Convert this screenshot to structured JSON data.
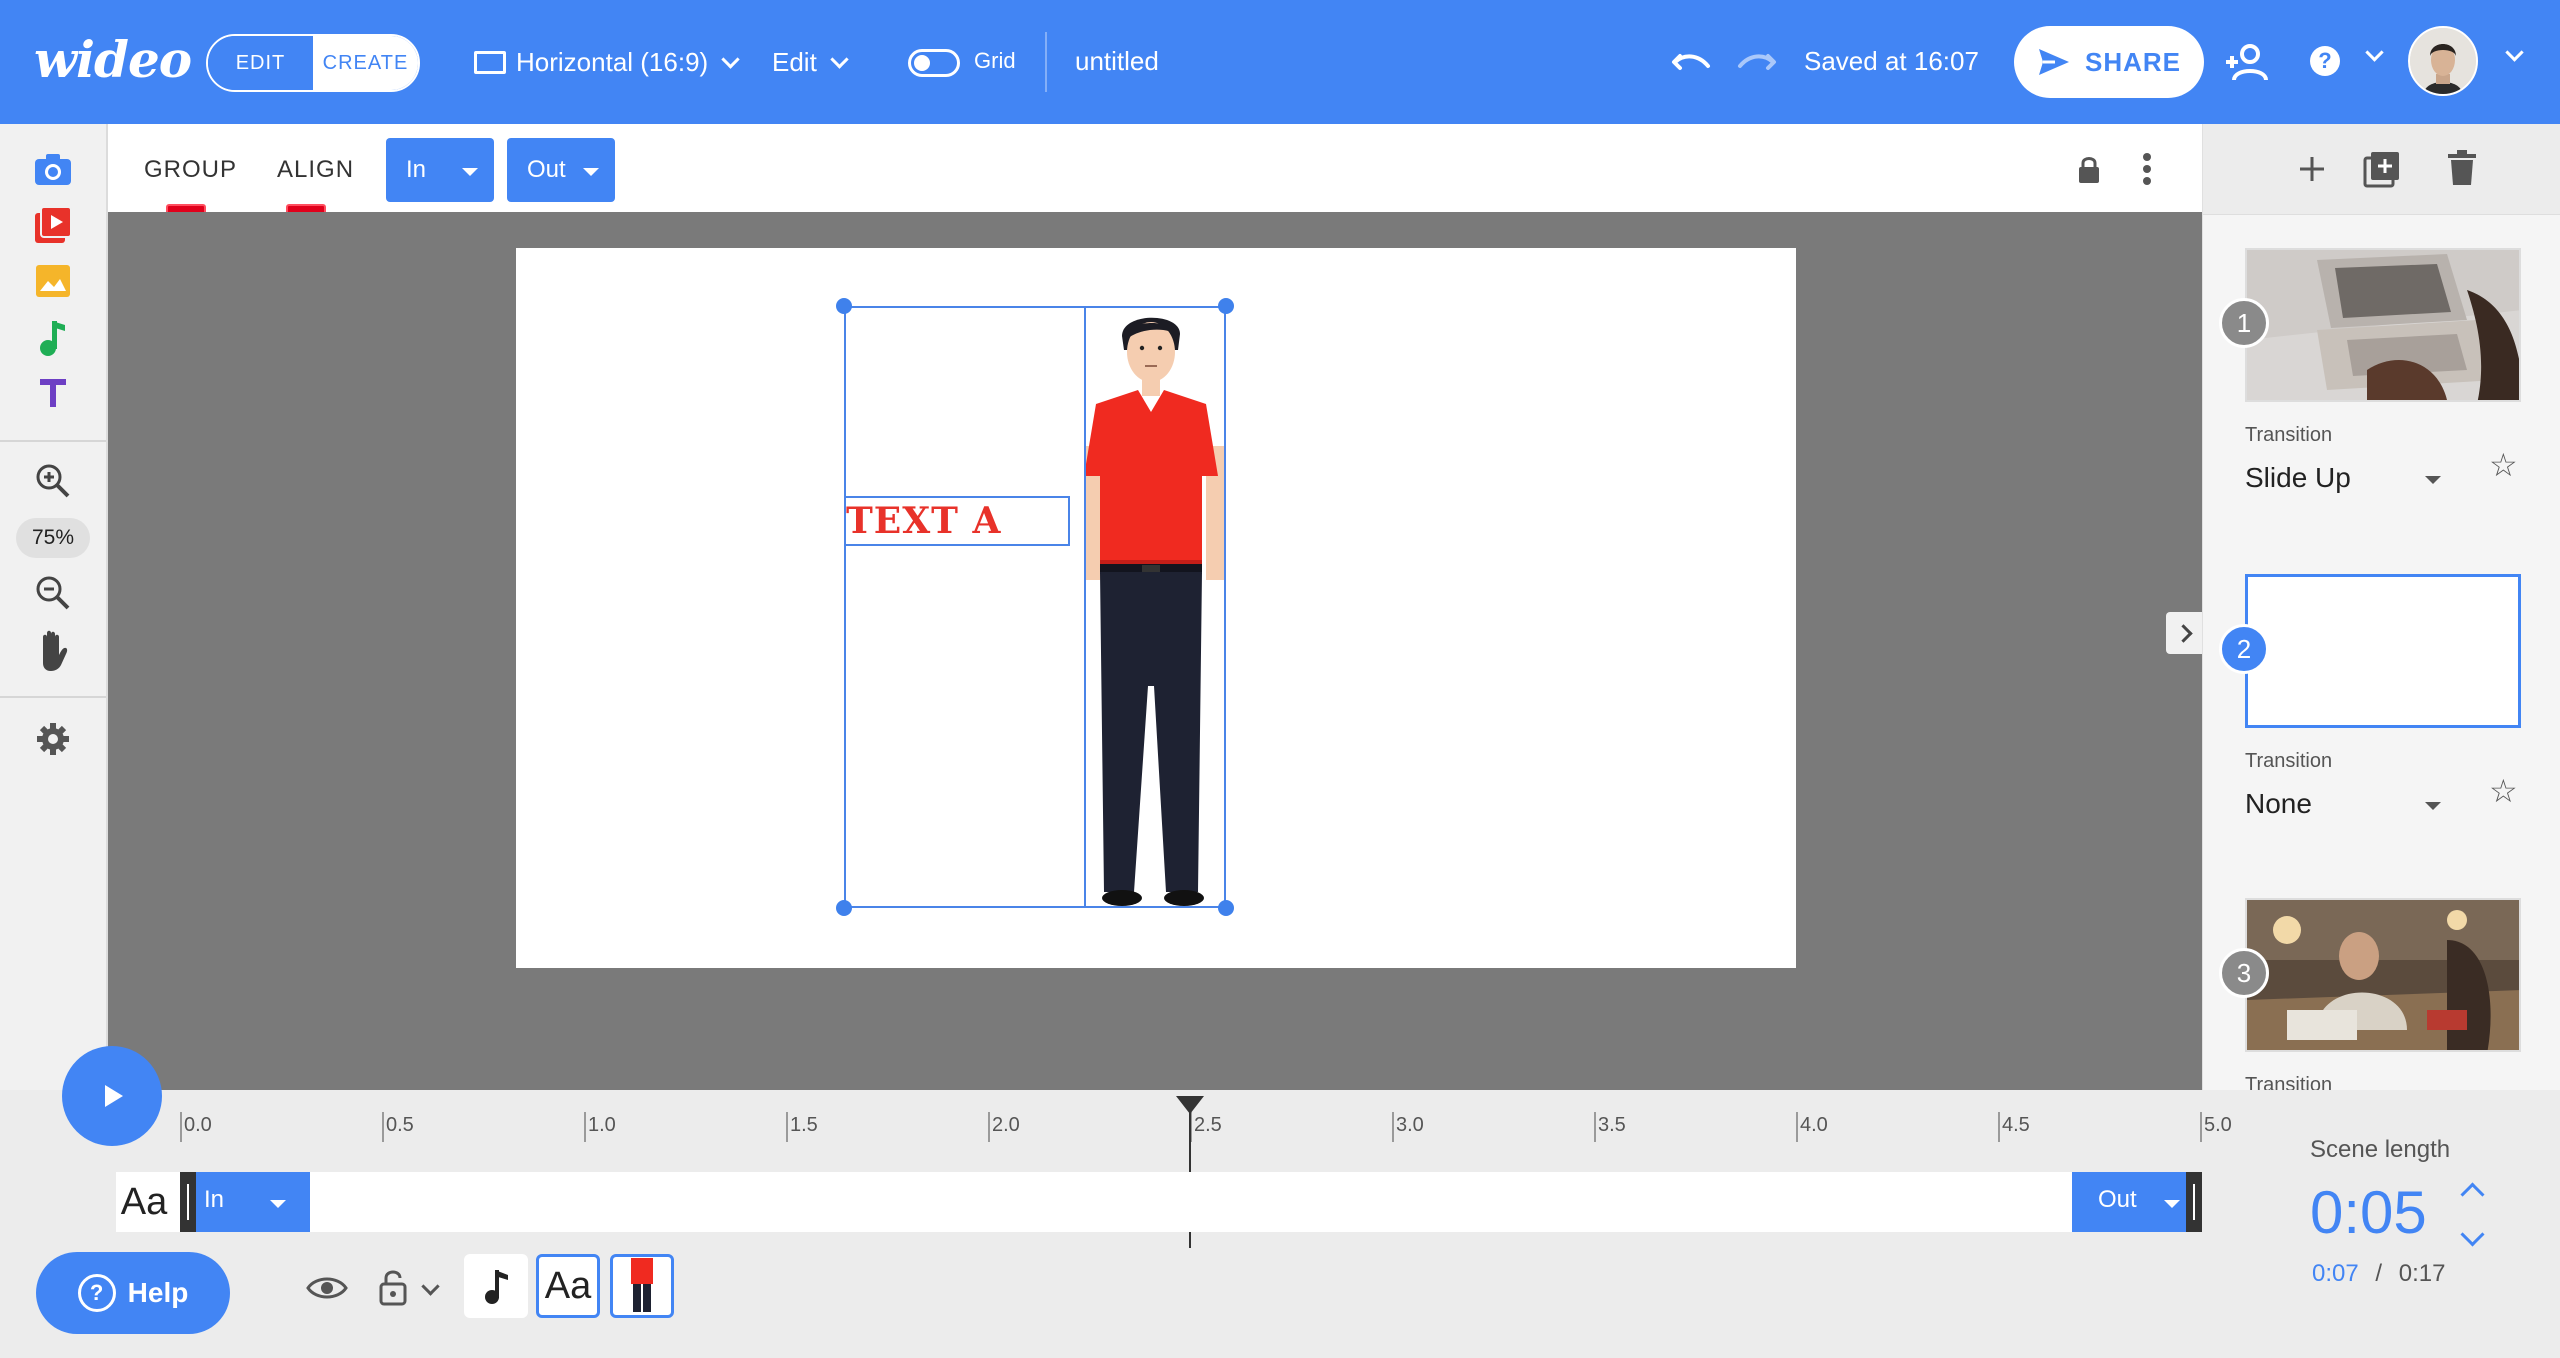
{
  "app": {
    "logo": "wideo"
  },
  "header": {
    "mode_edit": "EDIT",
    "mode_create": "CREATE",
    "format_label": "Horizontal (16:9)",
    "edit_menu": "Edit",
    "grid_label": "Grid",
    "grid_enabled": false,
    "doc_title": "untitled",
    "saved_status": "Saved at 16:07",
    "share_label": "SHARE",
    "help_glyph": "?"
  },
  "left_rail": {
    "tools": [
      "camera-icon",
      "video-icon",
      "image-icon",
      "music-icon",
      "text-icon"
    ],
    "zoom_level": "75%",
    "colors": {
      "camera": "#4285f4",
      "video": "#e8322a",
      "image": "#f5b52a",
      "music": "#1fae55",
      "text": "#6d3fc4"
    }
  },
  "toolbar": {
    "group_label": "GROUP",
    "align_label": "ALIGN",
    "in_label": "In",
    "out_label": "Out",
    "hint_group": "A",
    "hint_align": "B"
  },
  "stage": {
    "text_element": "TEXT A"
  },
  "scenes": [
    {
      "number": "1",
      "transition_label": "Transition",
      "transition": "Slide Up",
      "selected": false
    },
    {
      "number": "2",
      "transition_label": "Transition",
      "transition": "None",
      "selected": true
    },
    {
      "number": "3",
      "transition_label": "Transition",
      "transition": "",
      "selected": false
    }
  ],
  "timeline": {
    "ticks": [
      "0.0",
      "0.5",
      "1.0",
      "1.5",
      "2.0",
      "2.5",
      "3.0",
      "3.5",
      "4.0",
      "4.5",
      "5.0"
    ],
    "playhead_seconds": 2.5,
    "track_aa": "Aa",
    "track_in": "In",
    "track_out": "Out",
    "help_label": "Help",
    "help_glyph": "?",
    "layer_text": "Aa",
    "scene_length_label": "Scene length",
    "scene_length_value": "0:05",
    "scene_time_current": "0:07",
    "scene_time_separator": "/",
    "scene_time_total": "0:17"
  },
  "colors": {
    "accent": "#4285f4",
    "hint": "#e0001b",
    "workspace": "#7a7a7a",
    "text_red": "#e8322a"
  }
}
